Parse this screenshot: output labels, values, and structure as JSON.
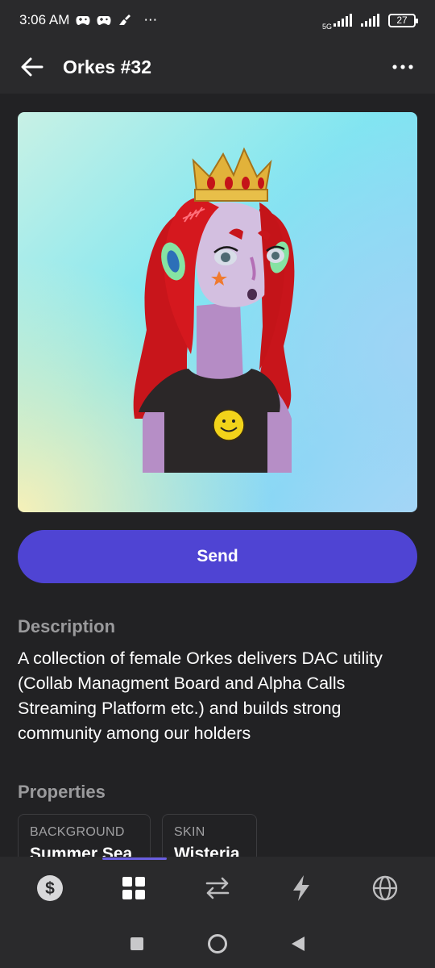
{
  "status_bar": {
    "time": "3:06 AM",
    "overflow": "⋯",
    "network": "5G",
    "battery": "27"
  },
  "app_bar": {
    "title": "Orkes #32",
    "back_icon": "arrow-left-icon",
    "more_icon": "more-horizontal-icon"
  },
  "nft": {
    "image_alt": "Orkes #32 artwork"
  },
  "actions": {
    "send_label": "Send"
  },
  "description": {
    "heading": "Description",
    "text": "A collection of female Orkes delivers DAC utility (Collab Managment Board and Alpha Calls Streaming Platform etc.) and builds strong community among our holders"
  },
  "properties": {
    "heading": "Properties",
    "items": [
      {
        "label": "BACKGROUND",
        "value": "Summer Sea"
      },
      {
        "label": "SKIN",
        "value": "Wisteria"
      }
    ]
  },
  "bottom_nav": {
    "items": [
      {
        "icon": "dollar-icon",
        "active": false
      },
      {
        "icon": "grid-icon",
        "active": true
      },
      {
        "icon": "swap-icon",
        "active": false
      },
      {
        "icon": "lightning-icon",
        "active": false
      },
      {
        "icon": "globe-icon",
        "active": false
      }
    ]
  },
  "colors": {
    "background": "#222224",
    "bar": "#2a2a2c",
    "accent": "#4f44d3",
    "muted_text": "#9a9a9c"
  }
}
